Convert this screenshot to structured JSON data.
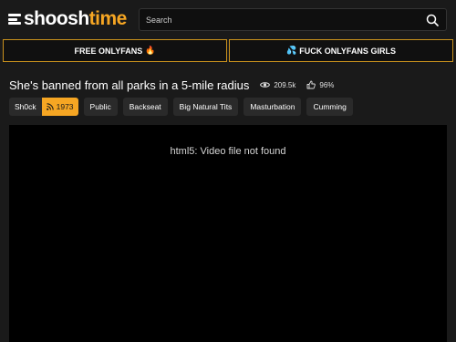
{
  "header": {
    "logo": {
      "part1": "shoosh",
      "part2": "time"
    },
    "search": {
      "placeholder": "Search"
    }
  },
  "promos": [
    {
      "label": "FREE ONLYFANS",
      "emoji": "🔥"
    },
    {
      "label": "FUCK ONLYFANS GIRLS",
      "emoji": "💦"
    }
  ],
  "video": {
    "title": "She's banned from all parks in a 5-mile radius",
    "views": "209.5k",
    "rating": "96%",
    "channel": {
      "name": "Sh0ck",
      "subscribers": "1973"
    },
    "tags": [
      "Public",
      "Backseat",
      "Big Natural Tits",
      "Masturbation",
      "Cumming"
    ]
  },
  "player": {
    "message": "html5: Video file not found"
  },
  "colors": {
    "accent": "#f6a623",
    "background": "#1a1a1a",
    "promo_border": "#c9911d",
    "tag_bg": "#2a2a2a"
  },
  "icons": {
    "search": "search-icon",
    "views": "eye-icon",
    "rating": "thumbs-up-icon",
    "subscribe": "rss-icon",
    "menu": "hamburger-icon"
  }
}
